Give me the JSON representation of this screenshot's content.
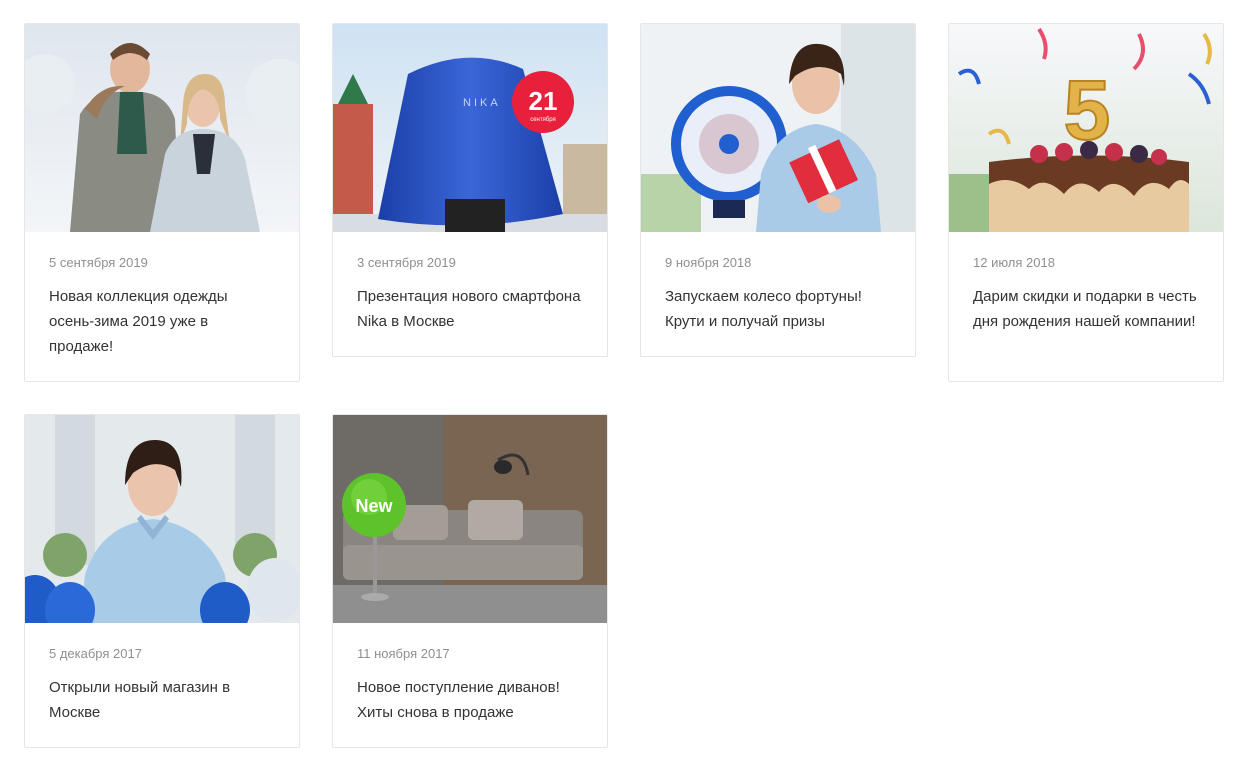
{
  "news": [
    {
      "date": "5 сентября 2019",
      "title": "Новая коллекция одежды осень-зима 2019 уже в продаже!",
      "image": "winter-couple-photo"
    },
    {
      "date": "3 сентября 2019",
      "title": "Презентация нового смартфона Nika в Москве",
      "image": "covered-phone-presentation-photo",
      "badge_number": "21",
      "badge_month": "сентября",
      "cover_text": "NIKA"
    },
    {
      "date": "9 ноября 2018",
      "title": "Запускаем колесо фортуны! Крути и получай призы",
      "image": "wheel-of-fortune-photo"
    },
    {
      "date": "12 июля 2018",
      "title": "Дарим скидки и подарки в честь дня рождения нашей компании!",
      "image": "birthday-cake-photo",
      "candle_number": "5"
    },
    {
      "date": "5 декабря 2017",
      "title": "Открыли новый магазин в Москве",
      "image": "store-opening-photo"
    },
    {
      "date": "11 ноября 2017",
      "title": "Новое поступление диванов! Хиты снова в продаже",
      "image": "sofa-photo",
      "badge_text": "New"
    }
  ],
  "colors": {
    "date": "#8f8f8f",
    "title": "#333333",
    "border": "#e6e6e6"
  }
}
